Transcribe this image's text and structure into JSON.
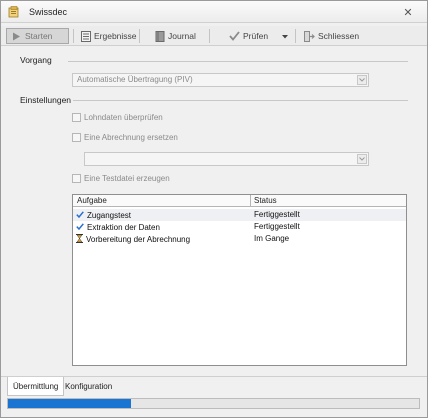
{
  "window": {
    "title": "Swissdec",
    "app_icon": "swissdec-icon",
    "close_icon": "close-icon"
  },
  "toolbar": {
    "start_label": "Starten",
    "results_label": "Ergebnisse",
    "journal_label": "Journal",
    "check_label": "Prüfen",
    "close_label": "Schliessen"
  },
  "vorgang": {
    "label": "Vorgang",
    "selected": "Automatische Übertragung (PIV)"
  },
  "einstellungen": {
    "label": "Einstellungen",
    "check_payroll": "Lohndaten überprüfen",
    "replace_payroll": "Eine Abrechnung ersetzen",
    "replace_selected": "",
    "test_file": "Eine Testdatei erzeugen"
  },
  "tasks": {
    "columns": [
      "Aufgabe",
      "Status"
    ],
    "rows": [
      {
        "task": "Zugangstest",
        "status": "Fertiggestellt",
        "icon": "check-icon"
      },
      {
        "task": "Extraktion der Daten",
        "status": "Fertiggestellt",
        "icon": "check-icon"
      },
      {
        "task": "Vorbereitung der Abrechnung",
        "status": "Im Gange",
        "icon": "hourglass-icon"
      }
    ]
  },
  "tabs": {
    "transmission": "Übermittlung",
    "configuration": "Konfiguration"
  },
  "progress": {
    "value": 0.3
  },
  "colors": {
    "accent": "#1a74d2",
    "check": "#2a6fd0"
  }
}
